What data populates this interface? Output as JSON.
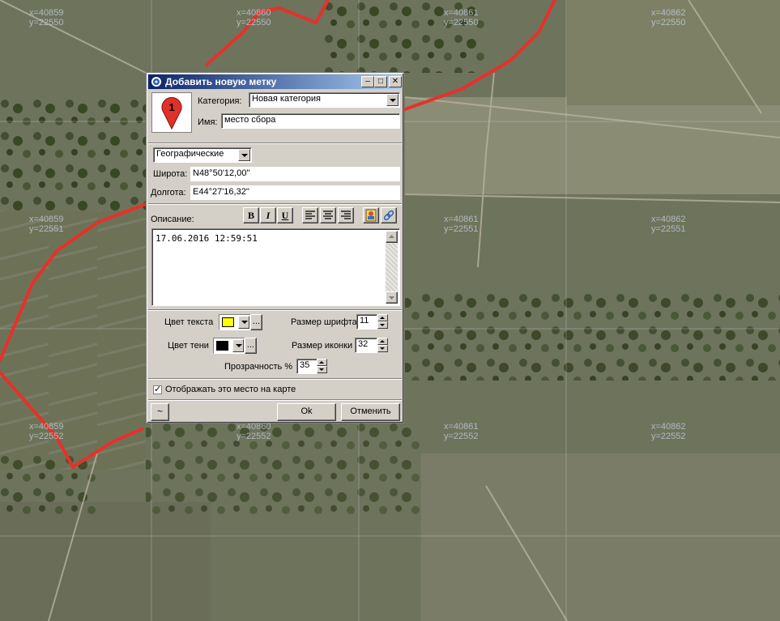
{
  "map": {
    "tile_labels": [
      {
        "x": "x=40860",
        "y": "y=22550"
      },
      {
        "x": "x=40861",
        "y": "y=22550"
      },
      {
        "x": "x=40862",
        "y": "y=22550"
      },
      {
        "x": "x=40859",
        "y": "y=22551"
      },
      {
        "x": "x=40861",
        "y": "y=22551"
      },
      {
        "x": "x=40862",
        "y": "y=22551"
      },
      {
        "x": "x=40859",
        "y": "y=22552"
      },
      {
        "x": "x=40860",
        "y": "y=22552"
      },
      {
        "x": "x=40861",
        "y": "y=22552"
      },
      {
        "x": "x=40862",
        "y": "y=22552"
      }
    ],
    "x40859_top": "x=40859",
    "y22550_top": "y=22550",
    "route_color": "#e8302a"
  },
  "dialog": {
    "title": "Добавить новую метку",
    "category_label": "Категория:",
    "category_value": "Новая категория",
    "name_label": "Имя:",
    "name_value": "место сбора",
    "marker_number": "1",
    "coord_system": "Географические",
    "latitude_label": "Широта:",
    "latitude_value": "N48°50'12,00\"",
    "longitude_label": "Долгота:",
    "longitude_value": "E44°27'16,32\"",
    "description_label": "Описание:",
    "description_text": "17.06.2016 12:59:51",
    "format_buttons": [
      "B",
      "I",
      "U"
    ],
    "text_color_label": "Цвет текста",
    "text_color": "#ffff00",
    "shadow_color_label": "Цвет тени",
    "shadow_color": "#000000",
    "font_size_label": "Размер шрифта",
    "font_size_value": "11",
    "icon_size_label": "Размер иконки",
    "icon_size_value": "32",
    "transparency_label": "Прозрачность %",
    "transparency_value": "35",
    "show_on_map_label": "Отображать это место на карте",
    "show_on_map_checked": true,
    "tilde_label": "~",
    "ok_label": "Ok",
    "cancel_label": "Отменить",
    "more_label": "..."
  }
}
